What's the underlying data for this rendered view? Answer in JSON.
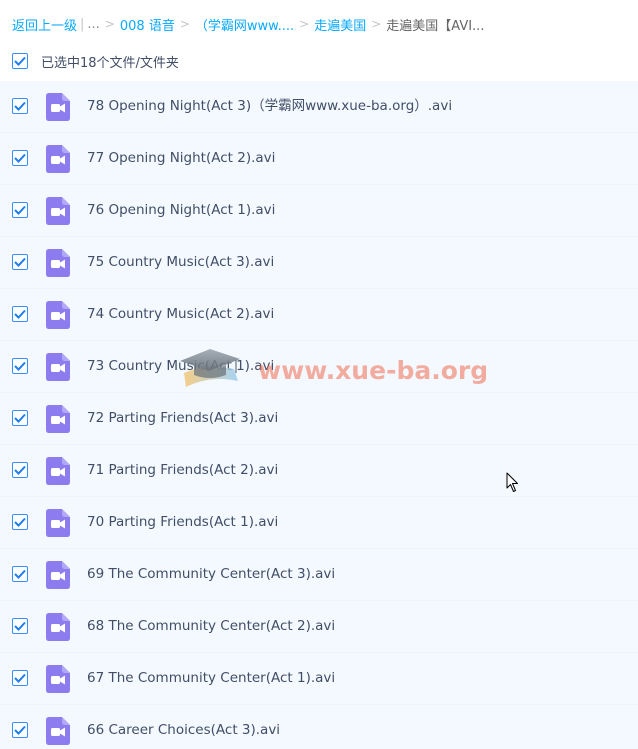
{
  "breadcrumb": {
    "back": "返回上一级",
    "ellipsis": "...",
    "items": [
      {
        "label": "008 语音"
      },
      {
        "label": "（学霸网www...."
      },
      {
        "label": "走遍美国"
      }
    ],
    "current": "走遍美国【AVI..."
  },
  "selection": {
    "label": "已选中18个文件/文件夹",
    "checked": true
  },
  "files": [
    {
      "name": "78 Opening Night(Act 3)（学霸网www.xue-ba.org）.avi",
      "type": "video",
      "checked": true
    },
    {
      "name": "77 Opening Night(Act 2).avi",
      "type": "video",
      "checked": true
    },
    {
      "name": "76 Opening Night(Act 1).avi",
      "type": "video",
      "checked": true
    },
    {
      "name": "75 Country Music(Act 3).avi",
      "type": "video",
      "checked": true
    },
    {
      "name": "74 Country Music(Act 2).avi",
      "type": "video",
      "checked": true
    },
    {
      "name": "73 Country Music(Act 1).avi",
      "type": "video",
      "checked": true
    },
    {
      "name": "72 Parting Friends(Act 3).avi",
      "type": "video",
      "checked": true
    },
    {
      "name": "71 Parting Friends(Act 2).avi",
      "type": "video",
      "checked": true
    },
    {
      "name": "70 Parting Friends(Act 1).avi",
      "type": "video",
      "checked": true
    },
    {
      "name": "69 The Community Center(Act 3).avi",
      "type": "video",
      "checked": true
    },
    {
      "name": "68 The Community Center(Act 2).avi",
      "type": "video",
      "checked": true
    },
    {
      "name": "67 The Community Center(Act 1).avi",
      "type": "video",
      "checked": true
    },
    {
      "name": "66 Career Choices(Act 3).avi",
      "type": "video",
      "checked": true
    }
  ],
  "watermark": {
    "text": "www.xue-ba.org",
    "icon": "graduation-cap-icon"
  },
  "colors": {
    "link": "#09aaff",
    "checkbox": "#3b8cff",
    "video_icon": "#8c7cf0",
    "row_bg": "#f3f9fe",
    "text": "#424e67"
  }
}
